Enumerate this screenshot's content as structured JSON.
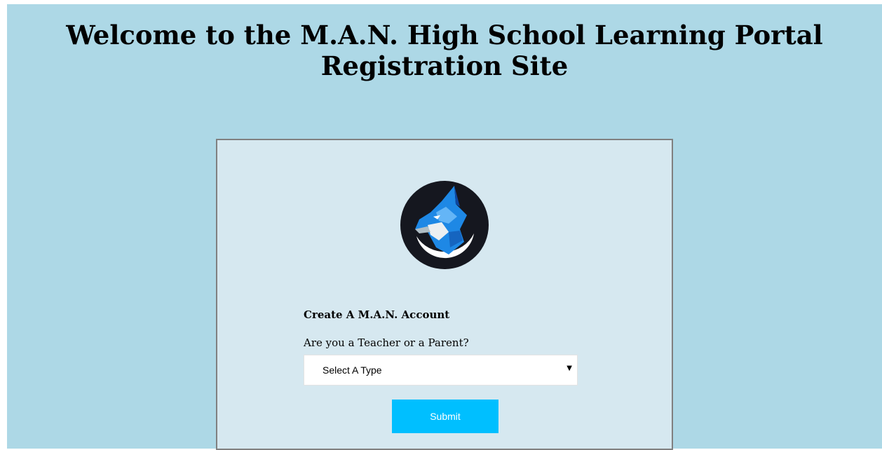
{
  "header": {
    "title_line1": "Welcome to the M.A.N. High School Learning Portal",
    "title_line2": "Registration Site"
  },
  "form": {
    "logo_icon": "wolf-logo-icon",
    "heading": "Create A M.A.N. Account",
    "question": "Are you a Teacher or a Parent?",
    "type_select": {
      "selected": "Select A Type"
    },
    "submit_label": "Submit"
  },
  "colors": {
    "page_background": "#add8e6",
    "card_background": "#d6e8f0",
    "submit_button": "#00bfff"
  }
}
